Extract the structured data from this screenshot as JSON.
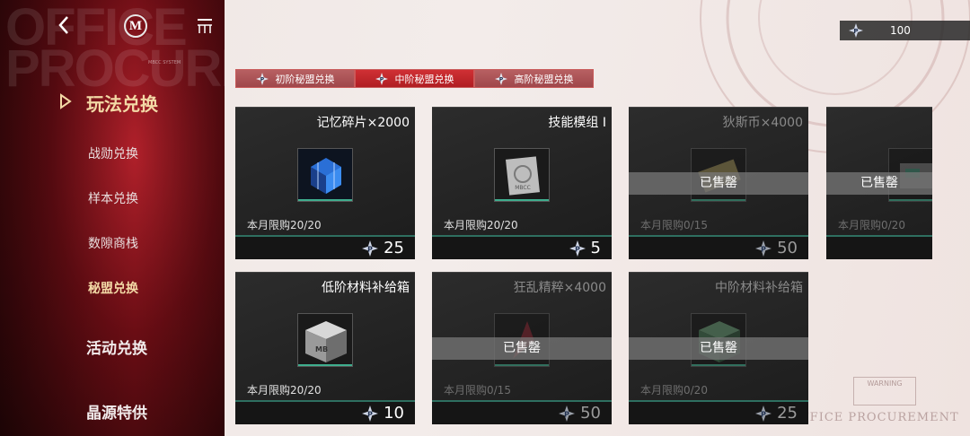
{
  "header": {
    "bg_title": "OFFICE PROCUREMENT",
    "system_tag": "MBCC SYSTEM",
    "logo_letter": "M"
  },
  "sidebar": {
    "main": "玩法兑换",
    "items": [
      {
        "label": "战勋兑换",
        "active": false
      },
      {
        "label": "样本兑换",
        "active": false
      },
      {
        "label": "数隙商栈",
        "active": false
      },
      {
        "label": "秘盟兑换",
        "active": true
      }
    ],
    "categories": [
      "活动兑换",
      "晶源特供"
    ]
  },
  "currency": {
    "icon": "secret-alliance-coin-icon",
    "value": "100"
  },
  "tabs": [
    {
      "label": "初阶秘盟兑换",
      "active": false
    },
    {
      "label": "中阶秘盟兑换",
      "active": true
    },
    {
      "label": "高阶秘盟兑换",
      "active": false
    }
  ],
  "items": [
    {
      "name": "记忆碎片×2000",
      "limit": "本月限购20/20",
      "price": "25",
      "sold_out": false,
      "icon": "memory-fragment-icon"
    },
    {
      "name": "技能模组 I",
      "limit": "本月限购20/20",
      "price": "5",
      "sold_out": false,
      "icon": "skill-module-icon"
    },
    {
      "name": "狄斯币×4000",
      "limit": "本月限购0/15",
      "price": "50",
      "sold_out": true,
      "sold_label": "已售罄",
      "icon": "dis-coin-icon"
    },
    {
      "name": "",
      "limit": "本月限购0/20",
      "price": "",
      "sold_out": true,
      "sold_label": "已售罄",
      "icon": "machine-icon"
    },
    {
      "name": "低阶材料补给箱",
      "limit": "本月限购20/20",
      "price": "10",
      "sold_out": false,
      "icon": "supply-crate-icon"
    },
    {
      "name": "狂乱精粹×4000",
      "limit": "本月限购0/15",
      "price": "50",
      "sold_out": true,
      "sold_label": "已售罄",
      "icon": "frenzy-essence-icon"
    },
    {
      "name": "中阶材料补给箱",
      "limit": "本月限购0/20",
      "price": "25",
      "sold_out": true,
      "sold_label": "已售罄",
      "icon": "mid-supply-crate-icon"
    }
  ],
  "decor": {
    "watermark": "OFFICE PROCUREMENT",
    "warning": "WARNING"
  },
  "colors": {
    "accent_red": "#b01e23",
    "gold": "#f3d9a6",
    "teal": "#3fae8e"
  }
}
